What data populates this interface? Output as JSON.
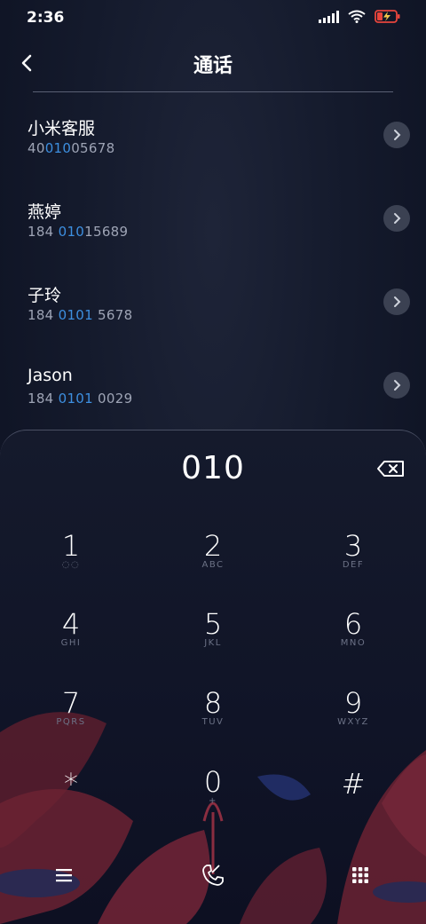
{
  "status_bar": {
    "time": "2:36"
  },
  "header": {
    "title": "通话"
  },
  "contacts": [
    {
      "name": "小米客服",
      "number_pre": "40",
      "number_hl": "010",
      "number_post": "05678"
    },
    {
      "name": "燕婷",
      "number_pre": "184 ",
      "number_hl": "010",
      "number_post": "15689"
    },
    {
      "name": "子玲",
      "number_pre": "184 ",
      "number_hl": "0101",
      "number_post": " 5678"
    },
    {
      "name": "Jason",
      "number_pre": "184 ",
      "number_hl": "0101",
      "number_post": " 0029"
    }
  ],
  "dialer": {
    "input": "010",
    "keys": [
      {
        "num": "1",
        "letters": "◌◌"
      },
      {
        "num": "2",
        "letters": "ABC"
      },
      {
        "num": "3",
        "letters": "DEF"
      },
      {
        "num": "4",
        "letters": "GHI"
      },
      {
        "num": "5",
        "letters": "JKL"
      },
      {
        "num": "6",
        "letters": "MNO"
      },
      {
        "num": "7",
        "letters": "PQRS"
      },
      {
        "num": "8",
        "letters": "TUV"
      },
      {
        "num": "9",
        "letters": "WXYZ"
      },
      {
        "num": "*",
        "letters": ""
      },
      {
        "num": "0",
        "letters": "+"
      },
      {
        "num": "#",
        "letters": ""
      }
    ]
  },
  "colors": {
    "highlight": "#3d8fe0",
    "background": "#141a2c"
  }
}
